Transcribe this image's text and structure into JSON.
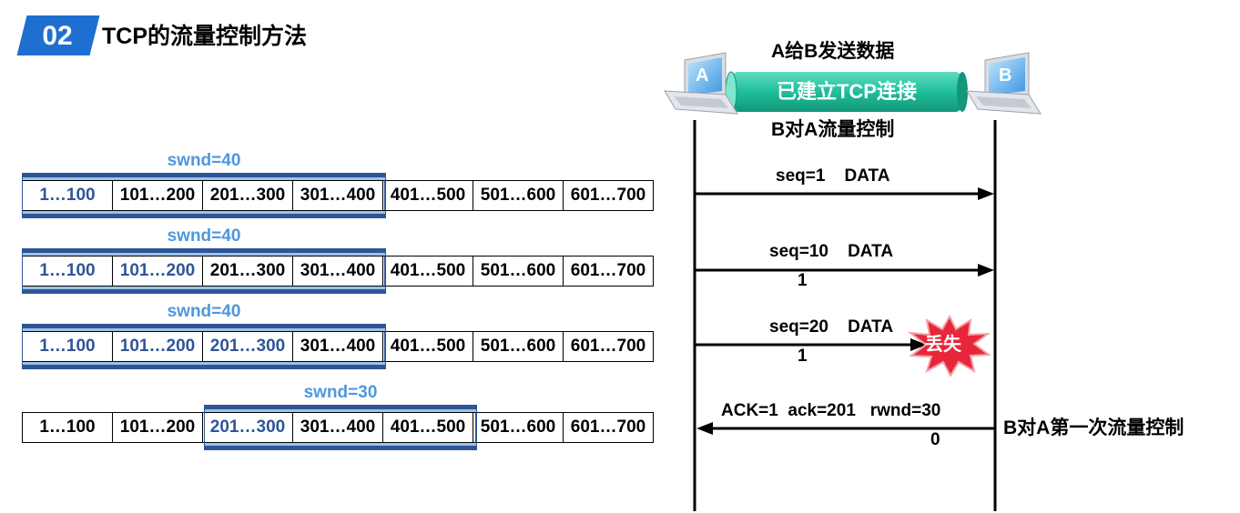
{
  "header": {
    "number": "02",
    "title": "TCP的流量控制方法"
  },
  "colors": {
    "accent": "#1f6fd1",
    "window_fill": "#9dc3e6",
    "window_border": "#2f5597",
    "swnd_text": "#4f97dd",
    "tube": "#1fbf9a",
    "lost_burst": "#e8263a"
  },
  "window_rows": [
    {
      "swnd_label": "swnd=40",
      "cells": [
        "1…100",
        "101…200",
        "201…300",
        "301…400",
        "401…500",
        "501…600",
        "601…700"
      ],
      "window_start": 0,
      "window_cells": 4,
      "sent_cells": 1
    },
    {
      "swnd_label": "swnd=40",
      "cells": [
        "1…100",
        "101…200",
        "201…300",
        "301…400",
        "401…500",
        "501…600",
        "601…700"
      ],
      "window_start": 0,
      "window_cells": 4,
      "sent_cells": 2
    },
    {
      "swnd_label": "swnd=40",
      "cells": [
        "1…100",
        "101…200",
        "201…300",
        "301…400",
        "401…500",
        "501…600",
        "601…700"
      ],
      "window_start": 0,
      "window_cells": 4,
      "sent_cells": 3
    },
    {
      "swnd_label": "swnd=30",
      "cells": [
        "1…100",
        "101…200",
        "201…300",
        "301…400",
        "401…500",
        "501…600",
        "601…700"
      ],
      "window_start": 2,
      "window_cells": 3,
      "sent_cells": 1
    }
  ],
  "diagram": {
    "host_a": "A",
    "host_b": "B",
    "top_label": "A给B发送数据",
    "connection_label": "已建立TCP连接",
    "bottom_label": "B对A流量控制",
    "lost_label": "丢失",
    "side_note": "B对A第一次流量控制",
    "messages": [
      {
        "text": "seq=1    DATA",
        "sub": ""
      },
      {
        "text": "seq=10    DATA",
        "sub": "1"
      },
      {
        "text": "seq=20    DATA",
        "sub": "1"
      },
      {
        "text": "ACK=1  ack=201   rwnd=30",
        "sub": "0"
      }
    ]
  }
}
